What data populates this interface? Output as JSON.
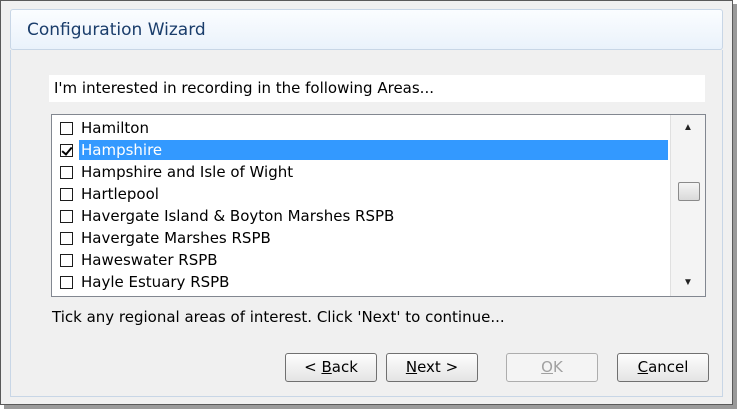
{
  "window": {
    "title": "Configuration Wizard"
  },
  "prompt": "I'm interested in recording in the following Areas...",
  "areas": [
    {
      "label": "Hamilton",
      "checked": false,
      "selected": false
    },
    {
      "label": "Hampshire",
      "checked": true,
      "selected": true
    },
    {
      "label": "Hampshire and Isle of Wight",
      "checked": false,
      "selected": false
    },
    {
      "label": "Hartlepool",
      "checked": false,
      "selected": false
    },
    {
      "label": "Havergate Island & Boyton Marshes RSPB",
      "checked": false,
      "selected": false
    },
    {
      "label": "Havergate Marshes RSPB",
      "checked": false,
      "selected": false
    },
    {
      "label": "Haweswater RSPB",
      "checked": false,
      "selected": false
    },
    {
      "label": "Hayle Estuary RSPB",
      "checked": false,
      "selected": false
    }
  ],
  "hint": "Tick any regional areas of interest.  Click 'Next' to continue...",
  "buttons": {
    "back": {
      "prefix": "< ",
      "accel": "B",
      "rest": "ack",
      "enabled": true
    },
    "next": {
      "prefix": "",
      "accel": "N",
      "rest": "ext >",
      "enabled": true
    },
    "ok": {
      "prefix": "",
      "accel": "O",
      "rest": "K",
      "enabled": false
    },
    "cancel": {
      "prefix": "",
      "accel": "C",
      "rest": "ancel",
      "enabled": true
    }
  },
  "colors": {
    "selection": "#3399ff",
    "title_text": "#1a3d6b"
  },
  "icons": {
    "scroll_up": "triangle-up",
    "scroll_down": "triangle-down",
    "checkmark": "check"
  }
}
